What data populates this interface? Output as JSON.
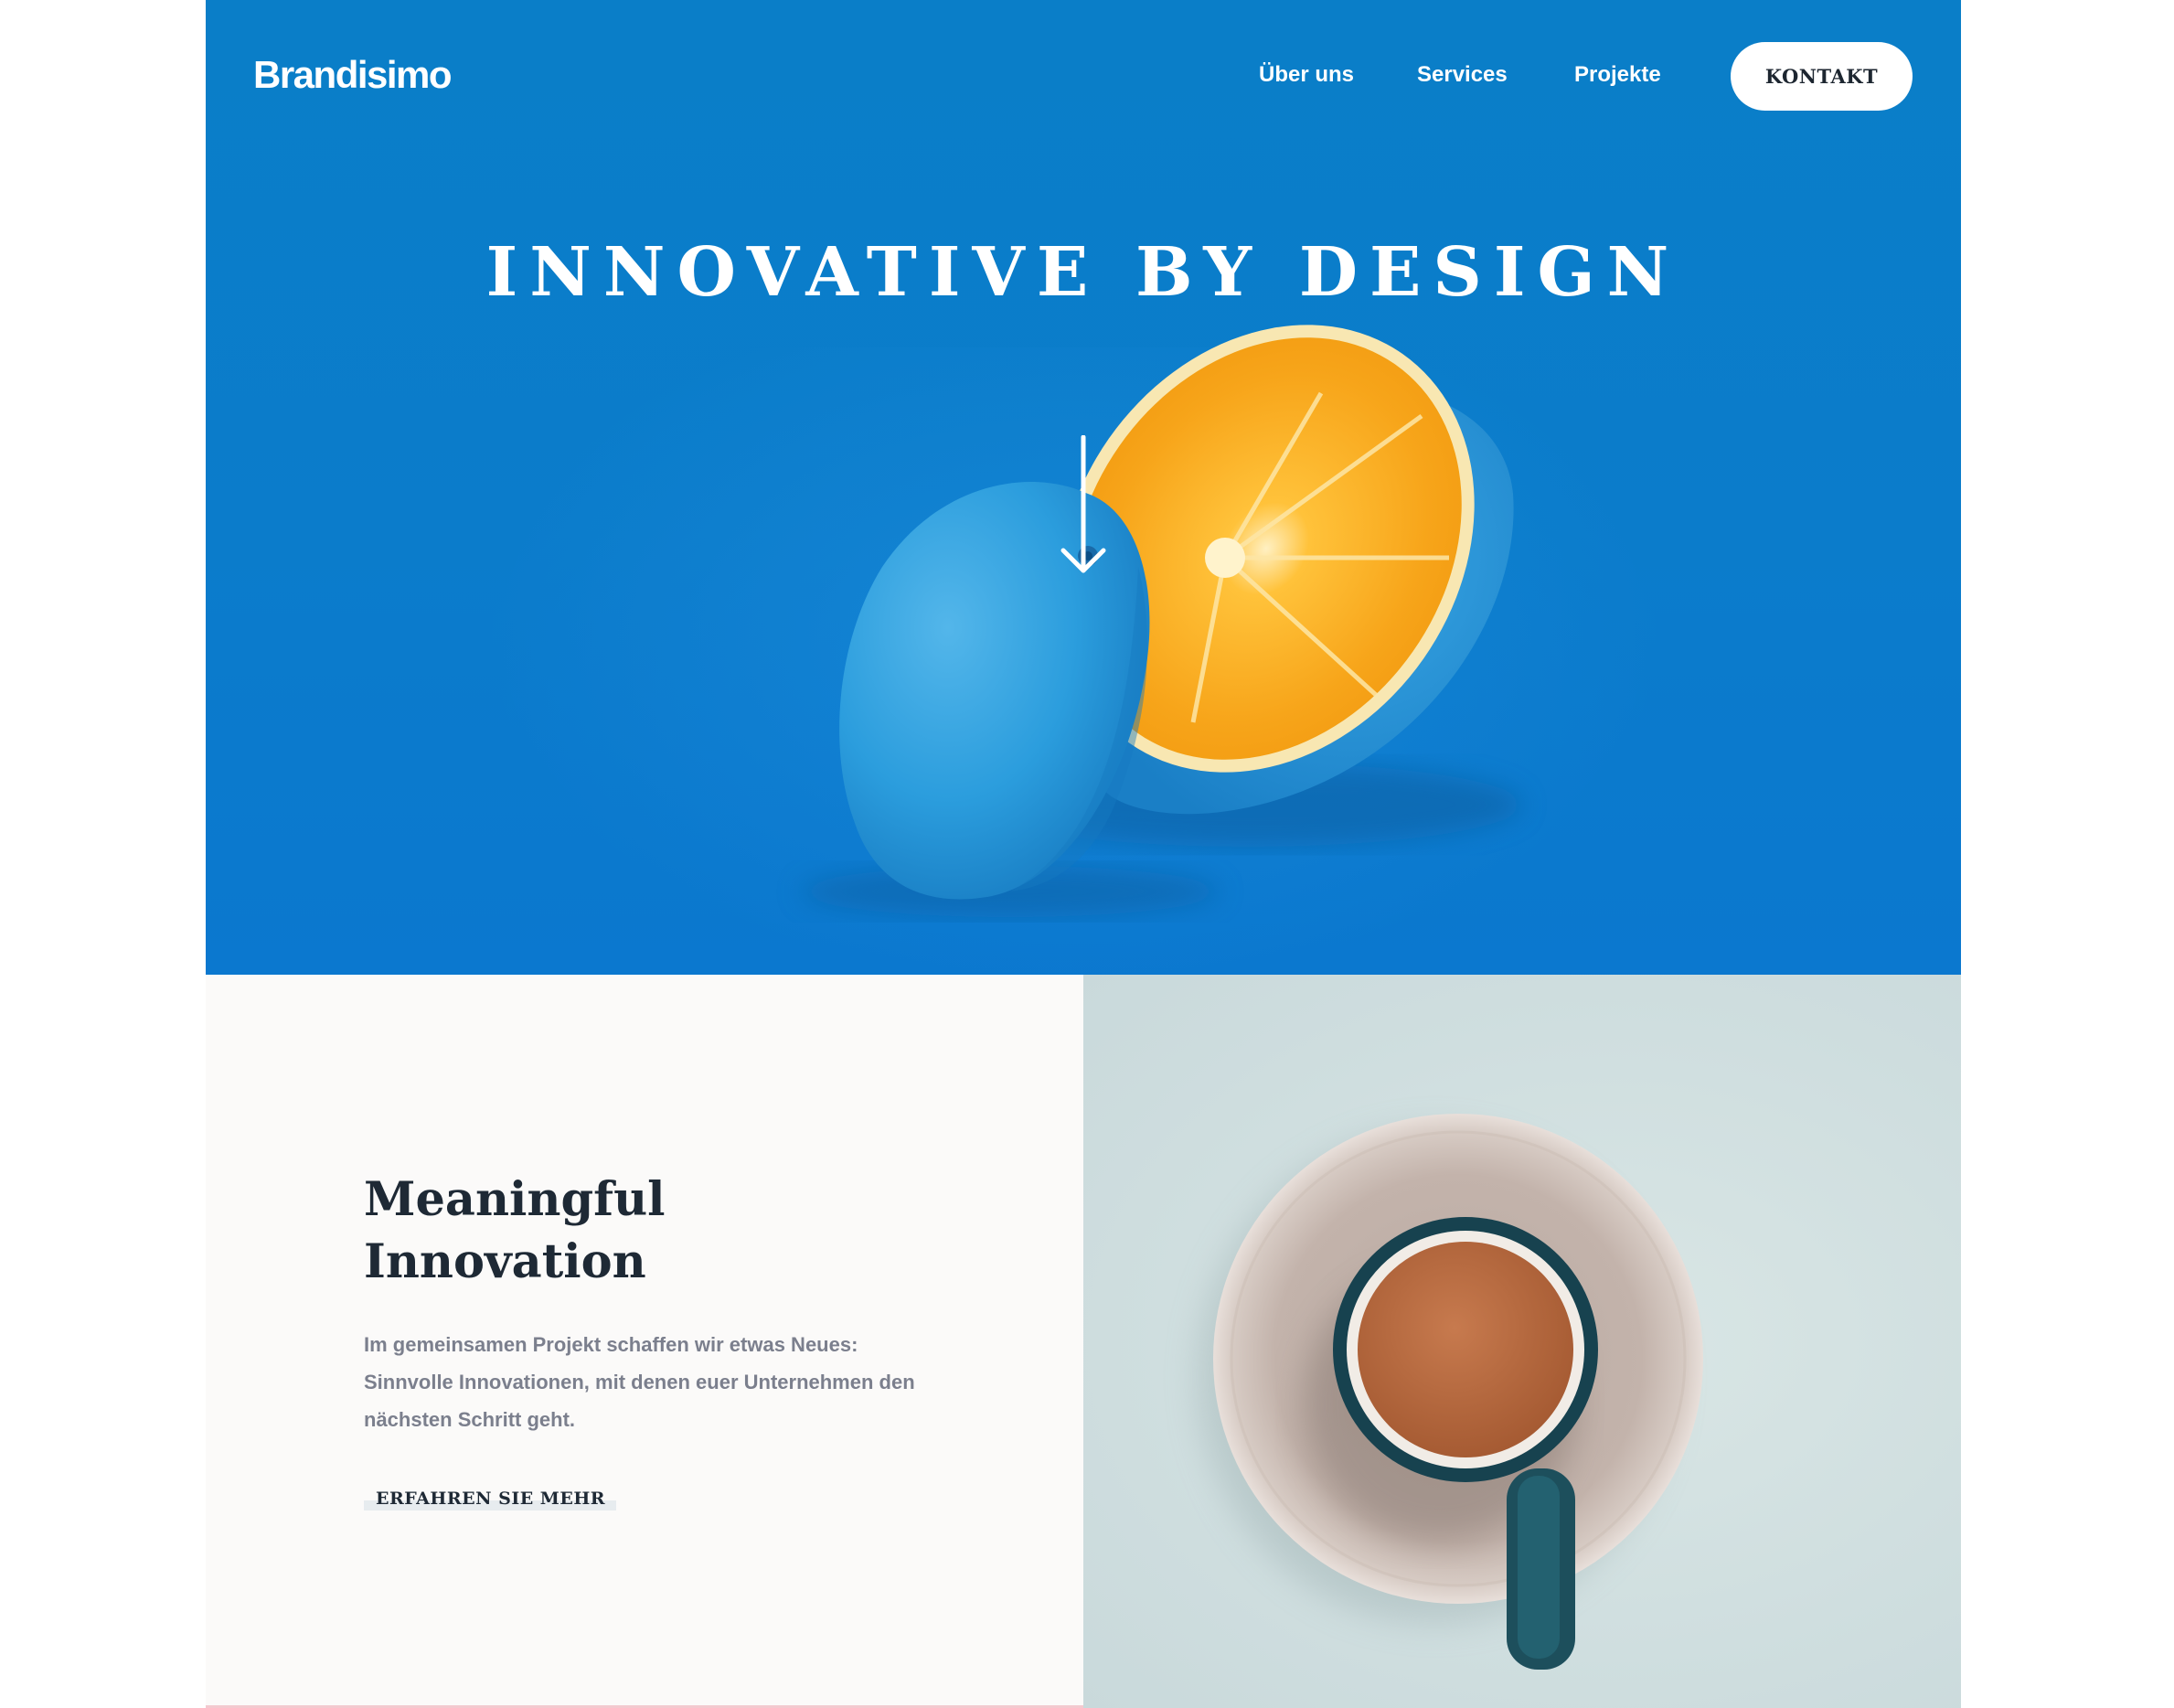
{
  "header": {
    "logo": "Brandisimo",
    "nav": [
      {
        "label": "Über uns"
      },
      {
        "label": "Services"
      },
      {
        "label": "Projekte"
      }
    ],
    "cta_label": "KONTAKT"
  },
  "hero": {
    "title": "INNOVATIVE BY DESIGN",
    "scroll_icon": "arrow-down-icon",
    "image": "blue-painted-orange-halves",
    "background_color": "#0a7ec8"
  },
  "feature": {
    "title_line1": "Meaningful",
    "title_line2": "Innovation",
    "text": "Im gemeinsamen Projekt schaffen wir etwas Neues: Sinnvolle Innovationen, mit denen euer Unternehmen den nächsten Schritt geht.",
    "link_label": "ERFAHREN SIE MEHR",
    "image": "coffee-cup-on-saucer"
  },
  "colors": {
    "hero_blue": "#0a7ec8",
    "heading_dark": "#1e2935",
    "body_gray": "#7b7f8d",
    "panel_light": "#fbfaf9",
    "panel_mint": "#cfdedf"
  }
}
